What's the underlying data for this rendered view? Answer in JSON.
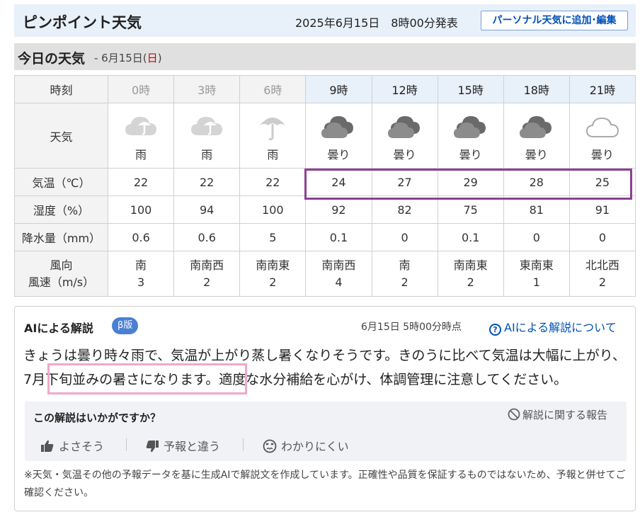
{
  "header": {
    "title": "ピンポイント天気",
    "published": "2025年6月15日　8時00分発表",
    "personal_button": "パーソナル天気に追加･編集"
  },
  "today": {
    "title": "今日の天気",
    "date_prefix": "- 6月15日(",
    "weekday": "日",
    "date_suffix": ")"
  },
  "table": {
    "row_labels": {
      "time": "時刻",
      "weather": "天気",
      "temp": "気温（℃）",
      "humidity": "湿度（%）",
      "rain": "降水量（mm）",
      "wind_dir": "風向",
      "wind_speed": "風速（m/s）"
    },
    "hours": [
      {
        "time": "0時",
        "icon": "cloud-umbrella-icon",
        "weather": "雨",
        "temp": "22",
        "humidity": "100",
        "rain": "0.6",
        "wind_dir": "南",
        "wind_speed": "3",
        "past": true
      },
      {
        "time": "3時",
        "icon": "cloud-umbrella-icon",
        "weather": "雨",
        "temp": "22",
        "humidity": "94",
        "rain": "0.6",
        "wind_dir": "南南西",
        "wind_speed": "2",
        "past": true
      },
      {
        "time": "6時",
        "icon": "umbrella-icon",
        "weather": "雨",
        "temp": "22",
        "humidity": "100",
        "rain": "5",
        "wind_dir": "南南東",
        "wind_speed": "2",
        "past": true
      },
      {
        "time": "9時",
        "icon": "double-cloud-icon",
        "weather": "曇り",
        "temp": "24",
        "humidity": "92",
        "rain": "0.1",
        "wind_dir": "南南西",
        "wind_speed": "4",
        "past": false
      },
      {
        "time": "12時",
        "icon": "double-cloud-icon",
        "weather": "曇り",
        "temp": "27",
        "humidity": "82",
        "rain": "0",
        "wind_dir": "南",
        "wind_speed": "2",
        "past": false
      },
      {
        "time": "15時",
        "icon": "double-cloud-icon",
        "weather": "曇り",
        "temp": "29",
        "humidity": "75",
        "rain": "0.1",
        "wind_dir": "南南東",
        "wind_speed": "2",
        "past": false
      },
      {
        "time": "18時",
        "icon": "double-cloud-icon",
        "weather": "曇り",
        "temp": "28",
        "humidity": "81",
        "rain": "0",
        "wind_dir": "東南東",
        "wind_speed": "1",
        "past": false
      },
      {
        "time": "21時",
        "icon": "light-cloud-icon",
        "weather": "曇り",
        "temp": "25",
        "humidity": "91",
        "rain": "0",
        "wind_dir": "北北西",
        "wind_speed": "2",
        "past": false
      }
    ]
  },
  "ai": {
    "title": "AIによる解説",
    "beta": "β版",
    "time": "6月15日 5時00分時点",
    "about_link": "AIによる解説について",
    "text": "きょうは曇り時々雨で、気温が上がり蒸し暑くなりそうです。きのうに比べて気温は大幅に上がり、7月下旬並みの暑さになります。適度な水分補給を心がけ、体調管理に注意してください。",
    "feedback": {
      "question": "この解説はいかがですか？",
      "report": "解説に関する報告",
      "good": "よさそう",
      "different": "予報と違う",
      "unclear": "わかりにくい"
    },
    "note": "※天気・気温その他の予報データを基に生成AIで解説文を作成しています。正確性や品質を保証するものではないため、予報と併せてご確認ください。"
  },
  "colors": {
    "temp_highlight": "#8e3f96",
    "text_highlight": "#f0a8c8",
    "link": "#0050b4",
    "beta_badge": "#4a7fd4"
  }
}
